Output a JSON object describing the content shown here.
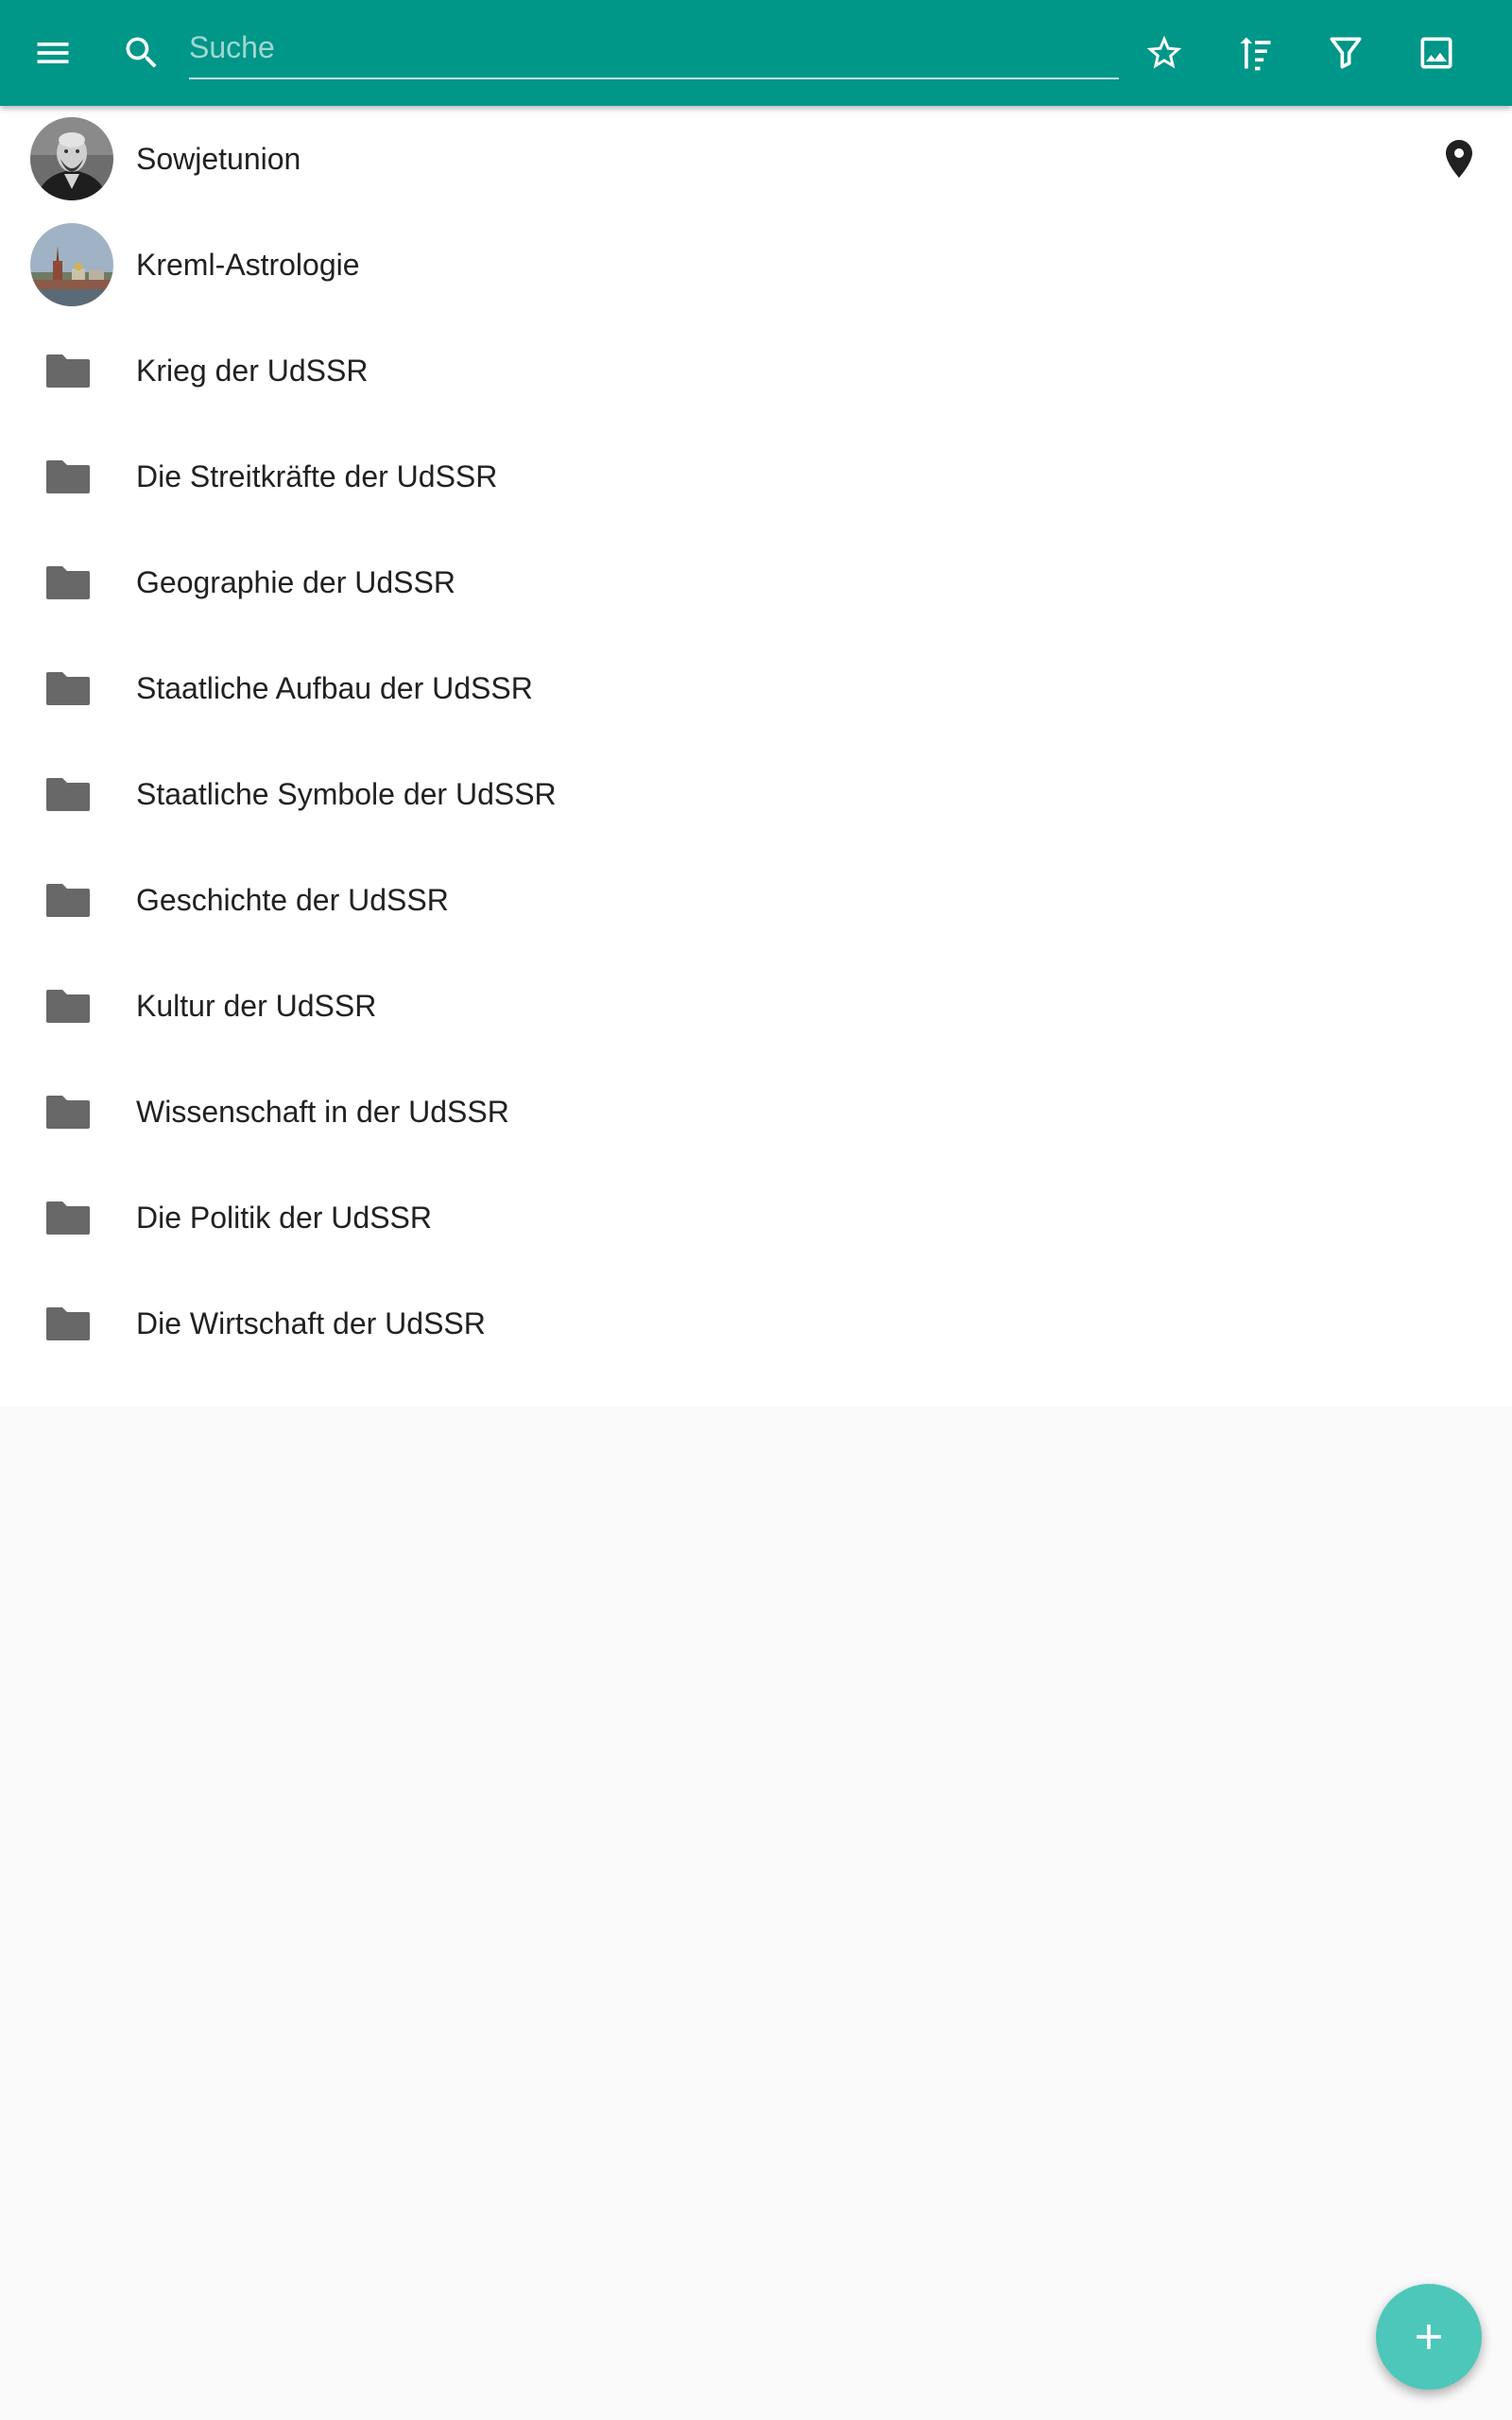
{
  "toolbar": {
    "color": "#009688",
    "icons": {
      "menu": "menu-icon",
      "search": "search-icon",
      "favorite": "star-outline-icon",
      "sort": "sort-icon",
      "filter": "filter-icon",
      "image": "image-icon"
    }
  },
  "search": {
    "placeholder": "Suche",
    "value": ""
  },
  "list": {
    "items": [
      {
        "label": "Sowjetunion",
        "type": "avatar",
        "icon": "portrait-avatar",
        "trailing_icon": "map-pin-icon"
      },
      {
        "label": "Kreml-Astrologie",
        "type": "avatar",
        "icon": "kremlin-avatar"
      },
      {
        "label": "Krieg der UdSSR",
        "type": "folder",
        "icon": "folder-icon"
      },
      {
        "label": "Die Streitkräfte der UdSSR",
        "type": "folder",
        "icon": "folder-icon"
      },
      {
        "label": "Geographie der UdSSR",
        "type": "folder",
        "icon": "folder-icon"
      },
      {
        "label": "Staatliche Aufbau der UdSSR",
        "type": "folder",
        "icon": "folder-icon"
      },
      {
        "label": "Staatliche Symbole der UdSSR",
        "type": "folder",
        "icon": "folder-icon"
      },
      {
        "label": "Geschichte der UdSSR",
        "type": "folder",
        "icon": "folder-icon"
      },
      {
        "label": "Kultur der UdSSR",
        "type": "folder",
        "icon": "folder-icon"
      },
      {
        "label": "Wissenschaft in der UdSSR",
        "type": "folder",
        "icon": "folder-icon"
      },
      {
        "label": "Die Politik der UdSSR",
        "type": "folder",
        "icon": "folder-icon"
      },
      {
        "label": "Die Wirtschaft der UdSSR",
        "type": "folder",
        "icon": "folder-icon"
      }
    ]
  },
  "fab": {
    "icon": "plus-icon",
    "color": "#4dc7b9"
  }
}
